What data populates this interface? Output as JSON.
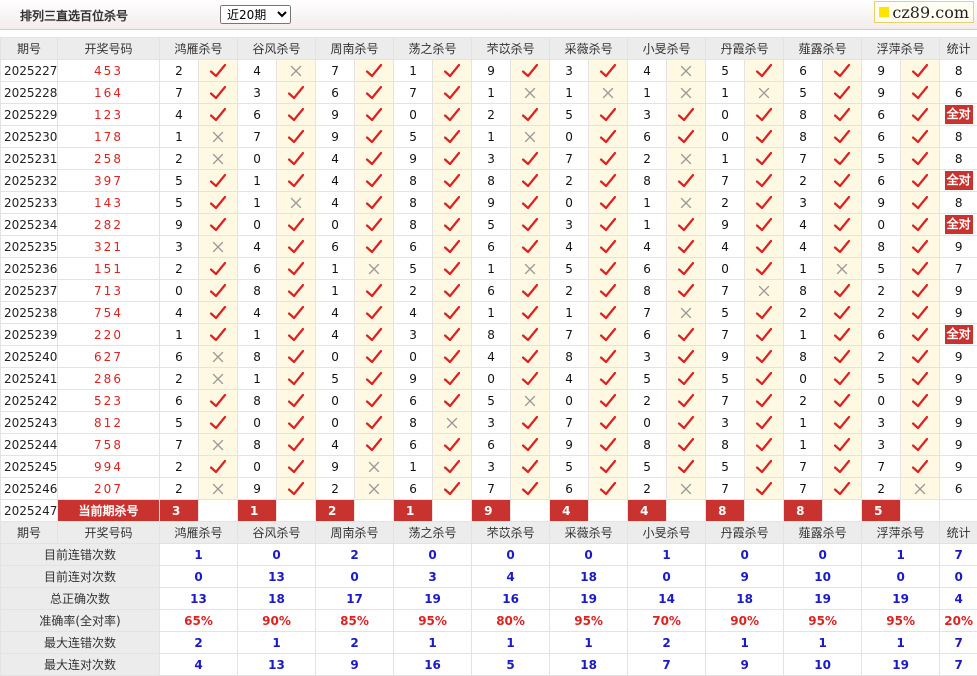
{
  "header": {
    "title": "排列三直选百位杀号",
    "period_select": {
      "value": "近20期",
      "options": [
        "近20期"
      ]
    },
    "brand": "cz89.com"
  },
  "table": {
    "col_period": "期号",
    "col_draw": "开奖号码",
    "col_total": "统计",
    "predictors": [
      "鸿雁杀号",
      "谷风杀号",
      "周南杀号",
      "荡之杀号",
      "芣苡杀号",
      "采薇杀号",
      "小旻杀号",
      "丹霞杀号",
      "薤露杀号",
      "浮萍杀号"
    ],
    "rows": [
      {
        "period": "2025227",
        "draw": "453",
        "picks": [
          2,
          4,
          7,
          1,
          9,
          3,
          4,
          5,
          6,
          9
        ],
        "hits": [
          1,
          0,
          1,
          1,
          1,
          1,
          0,
          1,
          1,
          1
        ],
        "total": "8"
      },
      {
        "period": "2025228",
        "draw": "164",
        "picks": [
          7,
          3,
          6,
          7,
          1,
          1,
          1,
          1,
          5,
          9
        ],
        "hits": [
          1,
          1,
          1,
          1,
          0,
          0,
          0,
          0,
          1,
          1
        ],
        "total": "6"
      },
      {
        "period": "2025229",
        "draw": "123",
        "picks": [
          4,
          6,
          9,
          0,
          2,
          5,
          3,
          0,
          8,
          6
        ],
        "hits": [
          1,
          1,
          1,
          1,
          1,
          1,
          1,
          1,
          1,
          1
        ],
        "total": "全对"
      },
      {
        "period": "2025230",
        "draw": "178",
        "picks": [
          1,
          7,
          9,
          5,
          1,
          0,
          6,
          0,
          8,
          6
        ],
        "hits": [
          0,
          1,
          1,
          1,
          0,
          1,
          1,
          1,
          1,
          1
        ],
        "total": "8"
      },
      {
        "period": "2025231",
        "draw": "258",
        "picks": [
          2,
          0,
          4,
          9,
          3,
          7,
          2,
          1,
          7,
          5
        ],
        "hits": [
          0,
          1,
          1,
          1,
          1,
          1,
          0,
          1,
          1,
          1
        ],
        "total": "8"
      },
      {
        "period": "2025232",
        "draw": "397",
        "picks": [
          5,
          1,
          4,
          8,
          8,
          2,
          8,
          7,
          2,
          6
        ],
        "hits": [
          1,
          1,
          1,
          1,
          1,
          1,
          1,
          1,
          1,
          1
        ],
        "total": "全对"
      },
      {
        "period": "2025233",
        "draw": "143",
        "picks": [
          5,
          1,
          4,
          8,
          9,
          0,
          1,
          2,
          3,
          9
        ],
        "hits": [
          1,
          0,
          1,
          1,
          1,
          1,
          0,
          1,
          1,
          1
        ],
        "total": "8"
      },
      {
        "period": "2025234",
        "draw": "282",
        "picks": [
          9,
          0,
          0,
          8,
          5,
          3,
          1,
          9,
          4,
          0
        ],
        "hits": [
          1,
          1,
          1,
          1,
          1,
          1,
          1,
          1,
          1,
          1
        ],
        "total": "全对"
      },
      {
        "period": "2025235",
        "draw": "321",
        "picks": [
          3,
          4,
          6,
          6,
          6,
          4,
          4,
          4,
          4,
          8
        ],
        "hits": [
          0,
          1,
          1,
          1,
          1,
          1,
          1,
          1,
          1,
          1
        ],
        "total": "9"
      },
      {
        "period": "2025236",
        "draw": "151",
        "picks": [
          2,
          6,
          1,
          5,
          1,
          5,
          6,
          0,
          1,
          5
        ],
        "hits": [
          1,
          1,
          0,
          1,
          0,
          1,
          1,
          1,
          0,
          1
        ],
        "total": "7"
      },
      {
        "period": "2025237",
        "draw": "713",
        "picks": [
          0,
          8,
          1,
          2,
          6,
          2,
          8,
          7,
          8,
          2
        ],
        "hits": [
          1,
          1,
          1,
          1,
          1,
          1,
          1,
          0,
          1,
          1
        ],
        "total": "9"
      },
      {
        "period": "2025238",
        "draw": "754",
        "picks": [
          4,
          4,
          4,
          4,
          1,
          1,
          7,
          5,
          2,
          2
        ],
        "hits": [
          1,
          1,
          1,
          1,
          1,
          1,
          0,
          1,
          1,
          1
        ],
        "total": "9"
      },
      {
        "period": "2025239",
        "draw": "220",
        "picks": [
          1,
          1,
          4,
          3,
          8,
          7,
          6,
          7,
          1,
          6
        ],
        "hits": [
          1,
          1,
          1,
          1,
          1,
          1,
          1,
          1,
          1,
          1
        ],
        "total": "全对"
      },
      {
        "period": "2025240",
        "draw": "627",
        "picks": [
          6,
          8,
          0,
          0,
          4,
          8,
          3,
          9,
          8,
          2
        ],
        "hits": [
          0,
          1,
          1,
          1,
          1,
          1,
          1,
          1,
          1,
          1
        ],
        "total": "9"
      },
      {
        "period": "2025241",
        "draw": "286",
        "picks": [
          2,
          1,
          5,
          9,
          0,
          4,
          5,
          5,
          0,
          5
        ],
        "hits": [
          0,
          1,
          1,
          1,
          1,
          1,
          1,
          1,
          1,
          1
        ],
        "total": "9"
      },
      {
        "period": "2025242",
        "draw": "523",
        "picks": [
          6,
          8,
          0,
          6,
          5,
          0,
          2,
          7,
          2,
          0
        ],
        "hits": [
          1,
          1,
          1,
          1,
          0,
          1,
          1,
          1,
          1,
          1
        ],
        "total": "9"
      },
      {
        "period": "2025243",
        "draw": "812",
        "picks": [
          5,
          0,
          0,
          8,
          3,
          7,
          0,
          3,
          1,
          3
        ],
        "hits": [
          1,
          1,
          1,
          0,
          1,
          1,
          1,
          1,
          1,
          1
        ],
        "total": "9"
      },
      {
        "period": "2025244",
        "draw": "758",
        "picks": [
          7,
          8,
          4,
          6,
          6,
          9,
          8,
          8,
          1,
          3
        ],
        "hits": [
          0,
          1,
          1,
          1,
          1,
          1,
          1,
          1,
          1,
          1
        ],
        "total": "9"
      },
      {
        "period": "2025245",
        "draw": "994",
        "picks": [
          2,
          0,
          9,
          1,
          3,
          5,
          5,
          5,
          7,
          7
        ],
        "hits": [
          1,
          1,
          0,
          1,
          1,
          1,
          1,
          1,
          1,
          1
        ],
        "total": "9"
      },
      {
        "period": "2025246",
        "draw": "207",
        "picks": [
          2,
          9,
          2,
          6,
          7,
          6,
          2,
          7,
          7,
          2
        ],
        "hits": [
          0,
          1,
          0,
          1,
          1,
          1,
          0,
          1,
          1,
          0
        ],
        "total": "6"
      }
    ],
    "current": {
      "period": "2025247",
      "label": "当前期杀号",
      "picks": [
        "3",
        "1",
        "2",
        "1",
        "9",
        "4",
        "4",
        "8",
        "8",
        "5"
      ]
    },
    "footer_header": {
      "period": "期号",
      "draw": "开奖号码",
      "total": "统计"
    },
    "stats": [
      {
        "label": "目前连错次数",
        "values": [
          "1",
          "0",
          "2",
          "0",
          "0",
          "0",
          "1",
          "0",
          "0",
          "1"
        ],
        "total": "7",
        "color": "blue"
      },
      {
        "label": "目前连对次数",
        "values": [
          "0",
          "13",
          "0",
          "3",
          "4",
          "18",
          "0",
          "9",
          "10",
          "0"
        ],
        "total": "0",
        "color": "blue"
      },
      {
        "label": "总正确次数",
        "values": [
          "13",
          "18",
          "17",
          "19",
          "16",
          "19",
          "14",
          "18",
          "19",
          "19"
        ],
        "total": "4",
        "color": "blue"
      },
      {
        "label": "准确率(全对率)",
        "values": [
          "65%",
          "90%",
          "85%",
          "95%",
          "80%",
          "95%",
          "70%",
          "90%",
          "95%",
          "95%"
        ],
        "total": "20%",
        "color": "red"
      },
      {
        "label": "最大连错次数",
        "values": [
          "2",
          "1",
          "2",
          "1",
          "1",
          "1",
          "2",
          "1",
          "1",
          "1"
        ],
        "total": "7",
        "color": "blue"
      },
      {
        "label": "最大连对次数",
        "values": [
          "4",
          "13",
          "9",
          "16",
          "5",
          "18",
          "7",
          "9",
          "10",
          "19"
        ],
        "total": "7",
        "color": "blue"
      }
    ]
  },
  "icons": {
    "hit": "check-icon",
    "miss": "cross-icon"
  },
  "colors": {
    "accent_red": "#c9332f",
    "check_red": "#e02020",
    "cross_gray": "#999999",
    "stat_blue": "#1a1ac8"
  }
}
